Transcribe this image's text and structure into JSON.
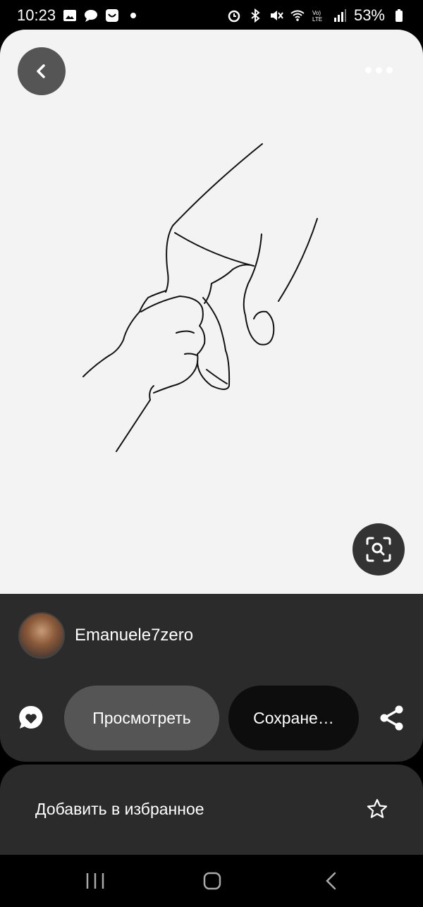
{
  "status_bar": {
    "time": "10:23",
    "battery": "53%",
    "left_icons": [
      "gallery-icon",
      "message-icon",
      "store-icon",
      "dot-icon"
    ],
    "right_icons": [
      "alarm-icon",
      "bluetooth-icon",
      "mute-icon",
      "wifi-icon",
      "volte-icon",
      "signal-icon",
      "battery-icon"
    ]
  },
  "pin": {
    "author": "Emanuele7zero",
    "view_label": "Просмотреть",
    "save_label": "Сохране…"
  },
  "favorites": {
    "label": "Добавить в избранное"
  },
  "colors": {
    "image_bg": "#f3f3f3",
    "panel_bg": "#2b2b2b",
    "view_btn": "#555555",
    "save_btn": "#0d0d0d"
  }
}
